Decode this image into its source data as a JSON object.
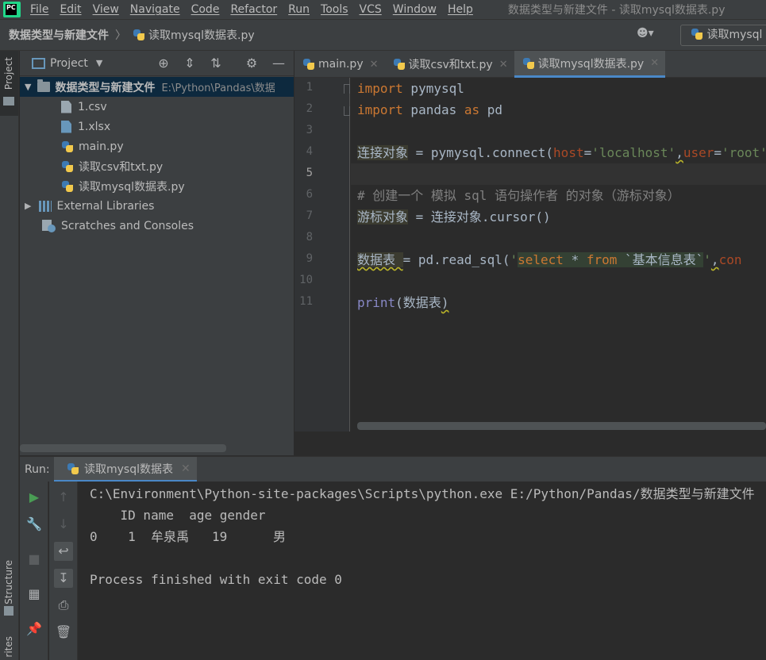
{
  "menubar": {
    "items": [
      "File",
      "Edit",
      "View",
      "Navigate",
      "Code",
      "Refactor",
      "Run",
      "Tools",
      "VCS",
      "Window",
      "Help"
    ],
    "window_title": "数据类型与新建文件 - 读取mysql数据表.py"
  },
  "navbar": {
    "breadcrumb_root": "数据类型与新建文件",
    "breadcrumb_file": "读取mysql数据表.py",
    "run_config": "读取mysql"
  },
  "left_strip": {
    "project_label": "Project",
    "structure_label": "Structure",
    "favorites_label": "rites"
  },
  "project_panel": {
    "title": "Project",
    "root_name": "数据类型与新建文件",
    "root_path": "E:\\Python\\Pandas\\数据",
    "files": [
      "1.csv",
      "1.xlsx",
      "main.py",
      "读取csv和txt.py",
      "读取mysql数据表.py"
    ],
    "external_libraries": "External Libraries",
    "scratches": "Scratches and Consoles"
  },
  "editor": {
    "tabs": [
      {
        "label": "main.py",
        "active": false
      },
      {
        "label": "读取csv和txt.py",
        "active": false
      },
      {
        "label": "读取mysql数据表.py",
        "active": true
      }
    ],
    "line_numbers": [
      "1",
      "2",
      "3",
      "4",
      "5",
      "6",
      "7",
      "8",
      "9",
      "10",
      "11"
    ],
    "current_line": 5
  },
  "run_panel": {
    "label": "Run:",
    "tab": "读取mysql数据表",
    "console_lines": [
      "C:\\Environment\\Python-site-packages\\Scripts\\python.exe E:/Python/Pandas/数据类型与新建文件",
      "    ID name  age gender",
      "0    1  牟泉禹   19      男",
      "",
      "Process finished with exit code 0"
    ]
  },
  "colors": {
    "bg": "#2b2b2b",
    "panel": "#3c3f41",
    "keyword": "#cc7832",
    "string": "#6a8759",
    "comment": "#808080",
    "param": "#aa4926",
    "accent": "#4a88c7",
    "run_green": "#499c54"
  }
}
